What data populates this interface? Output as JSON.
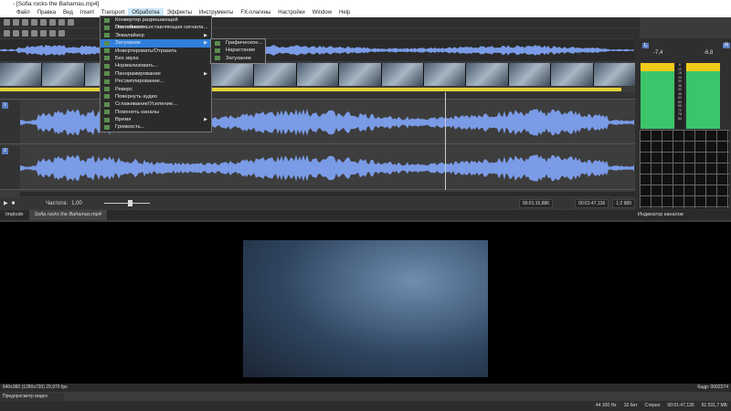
{
  "window": {
    "title": "- [Sofia rocks the Bahamas.mp4]"
  },
  "menubar": [
    "Файл",
    "Правка",
    "Вид",
    "Insert",
    "Transport",
    "Обработка",
    "Эффекты",
    "Инструменты",
    "FX-плагины",
    "Настройки",
    "Window",
    "Help"
  ],
  "process_menu": [
    {
      "label": "Конвертер разрешающей способности...",
      "submenu": false
    },
    {
      "label": "Постоянная составляющая сигнала...",
      "submenu": false
    },
    {
      "label": "Эквалайзер",
      "submenu": true
    },
    {
      "label": "Затухание",
      "submenu": true,
      "highlighted": true
    },
    {
      "label": "Инвертировать/Отразить",
      "submenu": false
    },
    {
      "label": "Без звука",
      "submenu": false
    },
    {
      "label": "Нормализовать...",
      "submenu": false
    },
    {
      "label": "Панорамирование",
      "submenu": true
    },
    {
      "label": "Ресэмплирование...",
      "submenu": false
    },
    {
      "label": "Реверс",
      "submenu": false
    },
    {
      "label": "Повернуть аудио",
      "submenu": false
    },
    {
      "label": "Сглаживание/Усиление...",
      "submenu": false
    },
    {
      "label": "Поменять каналы",
      "submenu": false
    },
    {
      "label": "Время",
      "submenu": true
    },
    {
      "label": "Громкость...",
      "submenu": false
    }
  ],
  "fade_submenu": [
    "Графическое...",
    "Нарастание",
    "Затухание"
  ],
  "tracks": [
    {
      "num": "1"
    },
    {
      "num": "2"
    }
  ],
  "transport": {
    "rate_label": "Частота:",
    "rate_value": "1,00",
    "cursor_time": "00:01:15,886",
    "length": "00:01:47,136",
    "zoom": "1:2 989"
  },
  "meters": {
    "left_label": "L",
    "right_label": "R",
    "left_peak": "-7,4",
    "right_peak": "-6,8",
    "scale": [
      "6",
      "12",
      "18",
      "24",
      "30",
      "36",
      "42",
      "48",
      "54",
      "60",
      "66",
      "72",
      "78",
      "84"
    ],
    "panel_title": "Индикатор каналов"
  },
  "tabs": {
    "explorer": "Implode",
    "file": "Sofia rocks the Bahamas.mp4"
  },
  "preview": {
    "info": "640x360 (1280x720) 29,970 fps",
    "frame": "Кадр: 0002274",
    "panel_label": "Предпросмотр видео"
  },
  "status": [
    "44 100 Hz",
    "16 бит",
    "Стерео",
    "00:01:47,136",
    "81 531,7 МБ"
  ],
  "colors": {
    "wave": "#7a9be6",
    "highlight": "#2f7fdc",
    "meter_green": "#3cc46a",
    "meter_yellow": "#f2cc1a"
  }
}
